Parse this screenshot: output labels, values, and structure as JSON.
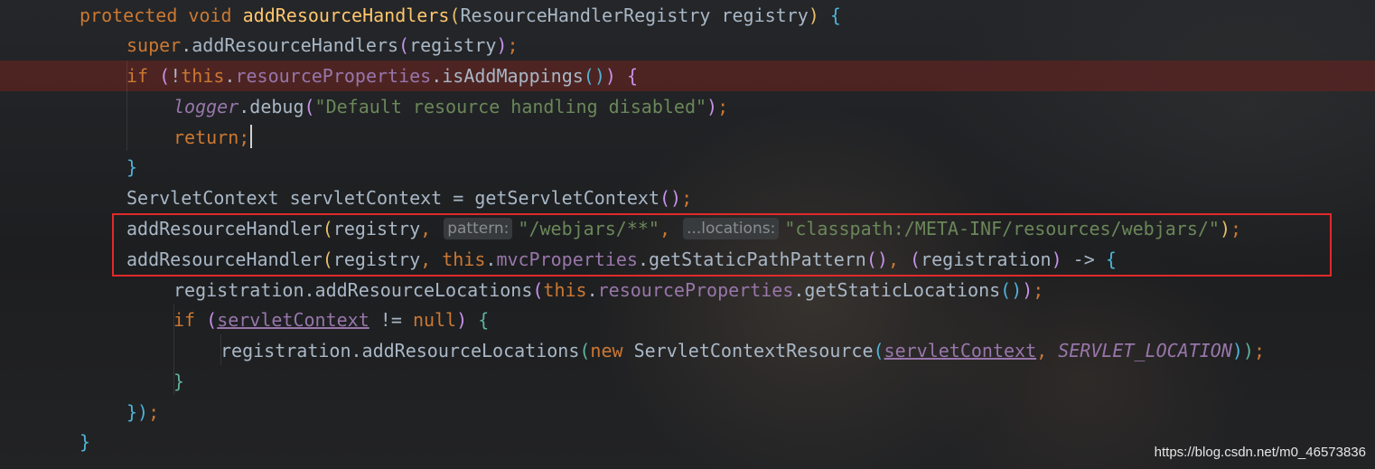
{
  "editor": {
    "lines": [
      [
        [
          "protected",
          "kw"
        ],
        [
          " ",
          "txt"
        ],
        [
          "void",
          "kw"
        ],
        [
          " ",
          "txt"
        ],
        [
          "addResourceHandlers",
          "fn"
        ],
        [
          "(",
          "p1"
        ],
        [
          "ResourceHandlerRegistry registry",
          "txt"
        ],
        [
          ")",
          "p1"
        ],
        [
          " ",
          "txt"
        ],
        [
          "{",
          "p3"
        ]
      ],
      [
        [
          "super",
          "kw"
        ],
        [
          ".addResourceHandlers",
          "txt"
        ],
        [
          "(",
          "p2"
        ],
        [
          "registry",
          "txt"
        ],
        [
          ")",
          "p2"
        ],
        [
          ";",
          "kw"
        ]
      ],
      [
        [
          "if",
          "kw"
        ],
        [
          " ",
          "txt"
        ],
        [
          "(",
          "p2"
        ],
        [
          "!",
          "txt"
        ],
        [
          "this",
          "kw"
        ],
        [
          ".",
          "txt"
        ],
        [
          "resourceProperties",
          "fld"
        ],
        [
          ".isAddMappings",
          "txt"
        ],
        [
          "()",
          "p3"
        ],
        [
          ")",
          "p2"
        ],
        [
          " ",
          "txt"
        ],
        [
          "{",
          "p2"
        ]
      ],
      [
        [
          "logger",
          "fld ital"
        ],
        [
          ".debug",
          "txt"
        ],
        [
          "(",
          "p2"
        ],
        [
          "\"Default resource handling disabled\"",
          "str"
        ],
        [
          ")",
          "p2"
        ],
        [
          ";",
          "kw"
        ]
      ],
      [
        [
          "return",
          "kw"
        ],
        [
          ";",
          "kw"
        ],
        [
          "",
          "caret"
        ]
      ],
      [
        [
          "}",
          "p3"
        ]
      ],
      [
        [
          "ServletContext servletContext = getServletContext",
          "txt"
        ],
        [
          "()",
          "p2"
        ],
        [
          ";",
          "kw"
        ]
      ],
      [
        [
          "addResourceHandler",
          "txt"
        ],
        [
          "(",
          "p1"
        ],
        [
          "registry",
          "txt"
        ],
        [
          ",",
          "kw"
        ],
        [
          " ",
          "txt"
        ],
        [
          "pattern:",
          "hint"
        ],
        [
          "\"/webjars/**\"",
          "str"
        ],
        [
          ",",
          "kw"
        ],
        [
          " ",
          "txt"
        ],
        [
          "...locations:",
          "hint"
        ],
        [
          "\"classpath:/META-INF/resources/webjars/\"",
          "str"
        ],
        [
          ")",
          "p1"
        ],
        [
          ";",
          "kw"
        ]
      ],
      [
        [
          "addResourceHandler",
          "txt"
        ],
        [
          "(",
          "p1"
        ],
        [
          "registry",
          "txt"
        ],
        [
          ",",
          "kw"
        ],
        [
          " ",
          "txt"
        ],
        [
          "this",
          "kw"
        ],
        [
          ".",
          "txt"
        ],
        [
          "mvcProperties",
          "fld"
        ],
        [
          ".getStaticPathPattern",
          "txt"
        ],
        [
          "()",
          "p2"
        ],
        [
          ",",
          "kw"
        ],
        [
          " ",
          "txt"
        ],
        [
          "(",
          "p2"
        ],
        [
          "registration",
          "txt"
        ],
        [
          ")",
          "p2"
        ],
        [
          " -> ",
          "txt"
        ],
        [
          "{",
          "p3"
        ]
      ],
      [
        [
          "registration.addResourceLocations",
          "txt"
        ],
        [
          "(",
          "p2"
        ],
        [
          "this",
          "kw"
        ],
        [
          ".",
          "txt"
        ],
        [
          "resourceProperties",
          "fld"
        ],
        [
          ".getStaticLocations",
          "txt"
        ],
        [
          "()",
          "p3"
        ],
        [
          ")",
          "p2"
        ],
        [
          ";",
          "kw"
        ]
      ],
      [
        [
          "if",
          "kw"
        ],
        [
          " ",
          "txt"
        ],
        [
          "(",
          "p2"
        ],
        [
          "servletContext",
          "fld ul"
        ],
        [
          " != ",
          "txt"
        ],
        [
          "null",
          "kw"
        ],
        [
          ")",
          "p2"
        ],
        [
          " ",
          "txt"
        ],
        [
          "{",
          "p4"
        ]
      ],
      [
        [
          "registration.addResourceLocations",
          "txt"
        ],
        [
          "(",
          "p4"
        ],
        [
          "new",
          "kw"
        ],
        [
          " ",
          "txt"
        ],
        [
          "ServletContextResource",
          "txt"
        ],
        [
          "(",
          "p3"
        ],
        [
          "servletContext",
          "fld ul"
        ],
        [
          ",",
          "kw"
        ],
        [
          " ",
          "txt"
        ],
        [
          "SERVLET_LOCATION",
          "fld ital"
        ],
        [
          ")",
          "p3"
        ],
        [
          ")",
          "p4"
        ],
        [
          ";",
          "kw"
        ]
      ],
      [
        [
          "}",
          "p4"
        ]
      ],
      [
        [
          "})",
          "p3"
        ],
        [
          ";",
          "kw"
        ]
      ],
      [
        [
          "}",
          "p3"
        ]
      ]
    ]
  },
  "watermark": "https://blog.csdn.net/m0_46573836"
}
